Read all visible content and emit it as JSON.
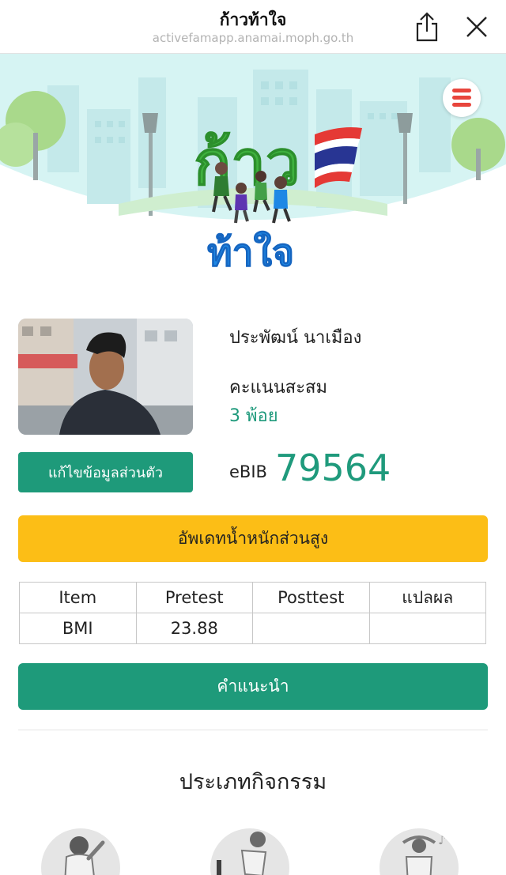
{
  "browser": {
    "title": "ก้าวท้าใจ",
    "url": "activefamapp.anamai.moph.go.th"
  },
  "logo": {
    "text_top": "ก้าว",
    "text_bottom": "ท้าใจ"
  },
  "profile": {
    "name": "ประพัฒน์ นาเมือง",
    "points_label": "คะแนนสะสม",
    "points_value": "3 พ้อย",
    "edit_label": "แก้ไขข้อมูลส่วนตัว",
    "ebib_label": "eBIB",
    "ebib_number": "79564"
  },
  "update_button": "อัพเดทน้ำหนักส่วนสูง",
  "table": {
    "headers": [
      "Item",
      "Pretest",
      "Posttest",
      "แปลผล"
    ],
    "rows": [
      [
        "BMI",
        "23.88",
        "",
        ""
      ]
    ]
  },
  "advice_button": "คำแนะนำ",
  "activity_section_title": "ประเภทกิจกรรม",
  "colors": {
    "primary_green": "#1e9a7a",
    "accent_yellow": "#fcbe16",
    "menu_red": "#e8453c",
    "banner_sky": "#d6f4f3"
  }
}
